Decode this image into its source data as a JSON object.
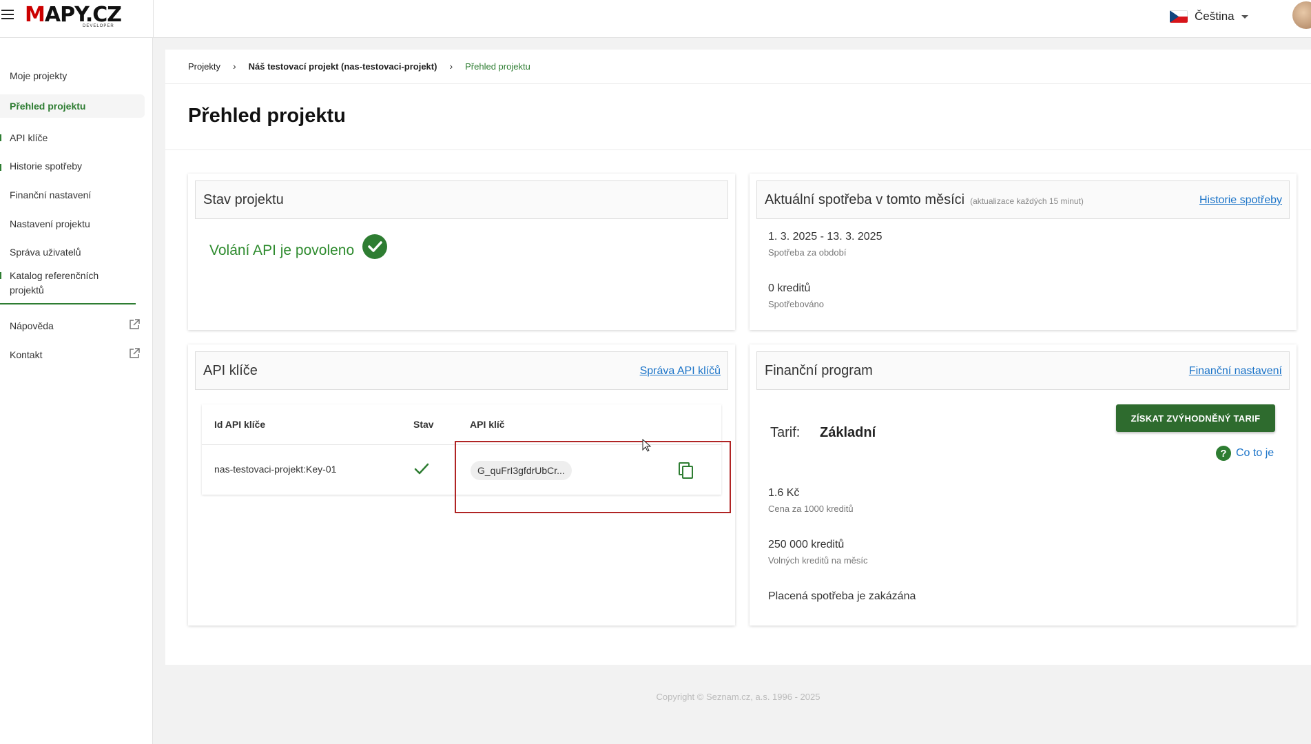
{
  "header": {
    "logo_text": "MAPY.CZ",
    "logo_sub": "DEVELOPER",
    "language": "Čeština"
  },
  "sidebar": {
    "items": [
      {
        "label": "Moje projekty"
      },
      {
        "label": "Přehled projektu"
      },
      {
        "label": "API klíče"
      },
      {
        "label": "Historie spotřeby"
      },
      {
        "label": "Finanční nastavení"
      },
      {
        "label": "Nastavení projektu"
      },
      {
        "label": "Správa uživatelů"
      },
      {
        "label": "Katalog referenčních projektů"
      }
    ],
    "external": [
      {
        "label": "Nápověda"
      },
      {
        "label": "Kontakt"
      }
    ]
  },
  "breadcrumb": {
    "root": "Projekty",
    "project": "Náš testovací projekt (nas-testovaci-projekt)",
    "current": "Přehled projektu"
  },
  "page_title": "Přehled projektu",
  "status_panel": {
    "title": "Stav projektu",
    "status": "Volání API je povoleno"
  },
  "usage_panel": {
    "title": "Aktuální spotřeba v tomto měsíci",
    "hint": "(aktualizace každých 15 minut)",
    "link": "Historie spotřeby",
    "period_value": "1. 3. 2025 - 13. 3. 2025",
    "period_label": "Spotřeba za období",
    "consumed_value": "0 kreditů",
    "consumed_label": "Spotřebováno"
  },
  "keys_panel": {
    "title": "API klíče",
    "link": "Správa API klíčů",
    "columns": [
      "Id API klíče",
      "Stav",
      "API klíč"
    ],
    "rows": [
      {
        "id": "nas-testovaci-projekt:Key-01",
        "key": "G_quFrI3gfdrUbCr..."
      }
    ]
  },
  "finance_panel": {
    "title": "Finanční program",
    "link": "Finanční nastavení",
    "cta": "ZÍSKAT ZVÝHODNĚNÝ TARIF",
    "help": "Co to je",
    "tarif_label": "Tarif:",
    "tarif_value": "Základní",
    "price_value": "1.6 Kč",
    "price_label": "Cena za 1000 kreditů",
    "free_value": "250 000 kreditů",
    "free_label": "Volných kreditů na měsíc",
    "paid_status": "Placená spotřeba je zakázána"
  },
  "footer": "Copyright © Seznam.cz, a.s. 1996 - 2025",
  "colors": {
    "brand_green": "#2e7d32",
    "link_blue": "#1a73c8",
    "highlight_red": "#b02424"
  }
}
